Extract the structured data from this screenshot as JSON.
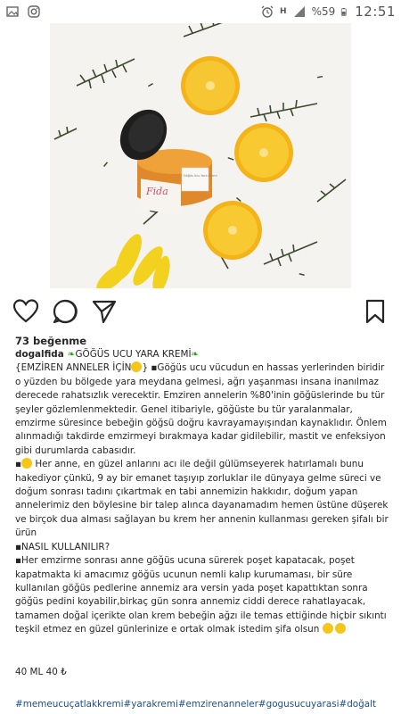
{
  "status_bar": {
    "time": "12:51",
    "battery": "%59",
    "network": "H"
  },
  "post": {
    "likes": "73 beğenme",
    "username": "dogalfida",
    "title": "GÖĞÜS UCU YARA KREMİ",
    "jar_label_brand": "Fida",
    "jar_label_text": "Göğüs Ucu Yara Kremi",
    "caption_line1": "{EMZİREN ANNELER İÇİN",
    "caption_line1_rest": "} ▪Göğüs ucu vücudun en hassas yerlerinden biridir o yüzden bu bölgede yara meydana gelmesi,  ağrı yaşanması insana inanılmaz derecede rahatsızlık verecektir. Emziren annelerin %80'inin göğüslerinde bu tür şeyler gözlemlenmektedir. Genel itibariyle, göğüste bu tür yaralanmalar, emzirme süresince bebeğin göğsü doğru kavrayamayışından kaynaklıdır. Önlem alınmadığı takdirde emzirmeyi bırakmaya kadar gidilebilir, mastit ve enfeksiyon gibi durumlarda cabasıdır.",
    "caption_para2": " Her anne, en güzel anlarını acı ile değil gülümseyerek hatırlamalı bunu hakediyor çünkü, 9 ay bir emanet taşıyıp zorluklar ile dünyaya gelme süreci ve doğum sonrası tadını çıkartmak en tabi annemizin hakkıdır, doğum yapan annelerimiz den böylesine bir talep alınca dayanamadım hemen üstüne düşerek ve birçok dua alması sağlayan bu krem her annenin kullanması gereken şifalı bir ürün",
    "caption_heading": "▪NASIL KULLANILIR?",
    "caption_para3": "▪Her emzirme sonrası anne göğüs ucuna sürerek poşet kapatacak, poşet kapatmakta ki amacımız göğüs ucunun nemli kalıp kurumaması, bir süre kullanılan göğüs pedlerine annemiz ara versin yada poşet kapattıktan sonra göğüs pedini koyabilir,birkaç gün sonra annemiz ciddi derece rahatlayacak, tamamen doğal içerikte olan krem bebeğin ağzı ile temas ettiğinde hiçbir sıkıntı teşkil etmez en güzel günlerinize e ortak olmak istedim şifa olsun",
    "price": "40 ML 40 ₺",
    "hashtags": "#memeucuçatlakkremi#yarakremi#emzirenanneler#gogusucuyarasi#doğalt"
  },
  "colors": {
    "hashtag": "#1c4f8a",
    "lemon": "#f5b81a",
    "jar_lid": "#1e1e1e"
  },
  "icons": [
    "heart-icon",
    "comment-icon",
    "share-icon",
    "bookmark-icon",
    "wifi-icon",
    "signal-icon",
    "battery-icon",
    "alarm-icon",
    "photo-icon",
    "instagram-icon"
  ]
}
